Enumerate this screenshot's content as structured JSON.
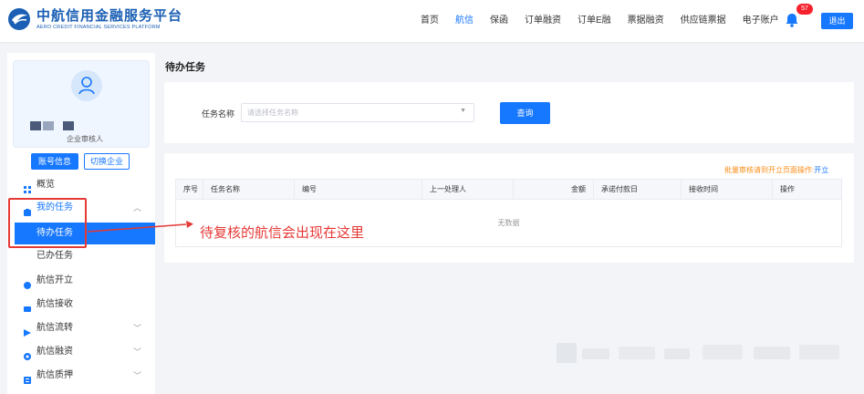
{
  "header": {
    "logo_cn": "中航信用金融服务平台",
    "logo_en": "AERO CREDIT FINANCIAL SERVICES PLATFORM",
    "nav": [
      {
        "label": "首页",
        "active": false
      },
      {
        "label": "航信",
        "active": true
      },
      {
        "label": "保函",
        "active": false
      },
      {
        "label": "订单融资",
        "active": false
      },
      {
        "label": "订单E融",
        "active": false
      },
      {
        "label": "票据融资",
        "active": false
      },
      {
        "label": "供应链票据",
        "active": false
      },
      {
        "label": "电子账户",
        "active": false
      }
    ],
    "notification_count": "57",
    "logout_label": "退出"
  },
  "sidebar": {
    "user_role": "企业审核人",
    "account_info_label": "账号信息",
    "switch_company_label": "切换企业",
    "menu": {
      "overview": "概览",
      "my_tasks": "我的任务",
      "pending_tasks": "待办任务",
      "done_tasks": "已办任务",
      "issue": "航信开立",
      "receive": "航信接收",
      "transfer": "航信流转",
      "financing": "航信融资",
      "pledge": "航信质押"
    }
  },
  "main": {
    "page_title": "待办任务",
    "filter": {
      "label": "任务名称",
      "placeholder": "请选择任务名称",
      "query_label": "查询"
    },
    "batch_tip": "批量审核请到开立页面操作:",
    "batch_link": "开立",
    "table": {
      "columns": [
        "序号",
        "任务名称",
        "编号",
        "上一处理人",
        "金额",
        "承诺付款日",
        "接收时间",
        "操作"
      ],
      "empty_text": "无数据"
    }
  },
  "annotation": {
    "text": "待复核的航信会出现在这里",
    "color": "#e53935"
  },
  "colors": {
    "primary": "#1677ff",
    "warning": "#fa8c16",
    "annotation": "#e53935"
  }
}
